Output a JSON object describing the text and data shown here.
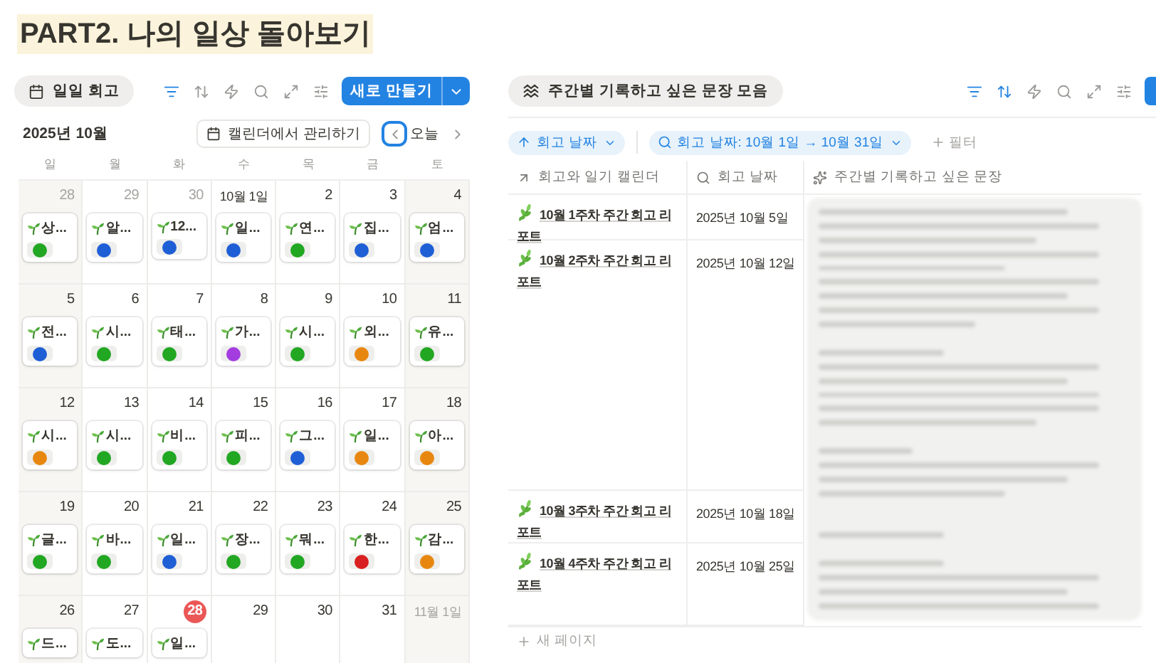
{
  "page_title": "PART2. 나의 일상 돌아보기",
  "calendar": {
    "view_tab": "일일 회고",
    "toolbar": [
      {
        "kind": "filter",
        "active": true
      },
      {
        "kind": "sort",
        "active": false
      },
      {
        "kind": "automation",
        "active": false
      },
      {
        "kind": "search",
        "active": false
      },
      {
        "kind": "expand",
        "active": false
      },
      {
        "kind": "settings",
        "active": false
      }
    ],
    "new_button": "새로 만들기",
    "month": "2025년 10월",
    "manage_button": "캘린더에서 관리하기",
    "today_button": "오늘",
    "weekdays": [
      "일",
      "월",
      "화",
      "수",
      "목",
      "금",
      "토"
    ],
    "weeks": [
      [
        {
          "date": "28",
          "muted": true,
          "today": false,
          "entry": {
            "text": "상...",
            "color": "#22a722"
          }
        },
        {
          "date": "29",
          "muted": true,
          "today": false,
          "entry": {
            "text": "알...",
            "color": "#1f5fd6"
          }
        },
        {
          "date": "30",
          "muted": true,
          "today": false,
          "entry": {
            "text": "12...",
            "color": "#1f5fd6"
          }
        },
        {
          "date": "10월 1일",
          "muted": false,
          "today": false,
          "entry": {
            "text": "일...",
            "color": "#1f5fd6"
          }
        },
        {
          "date": "2",
          "muted": false,
          "today": false,
          "entry": {
            "text": "연...",
            "color": "#22a722"
          }
        },
        {
          "date": "3",
          "muted": false,
          "today": false,
          "entry": {
            "text": "집...",
            "color": "#1f5fd6"
          }
        },
        {
          "date": "4",
          "muted": false,
          "today": false,
          "entry": {
            "text": "엄...",
            "color": "#1f5fd6"
          }
        }
      ],
      [
        {
          "date": "5",
          "muted": false,
          "today": false,
          "entry": {
            "text": "전...",
            "color": "#1f5fd6"
          }
        },
        {
          "date": "6",
          "muted": false,
          "today": false,
          "entry": {
            "text": "시...",
            "color": "#22a722"
          }
        },
        {
          "date": "7",
          "muted": false,
          "today": false,
          "entry": {
            "text": "태...",
            "color": "#22a722"
          }
        },
        {
          "date": "8",
          "muted": false,
          "today": false,
          "entry": {
            "text": "가...",
            "color": "#a43de0"
          }
        },
        {
          "date": "9",
          "muted": false,
          "today": false,
          "entry": {
            "text": "시...",
            "color": "#22a722"
          }
        },
        {
          "date": "10",
          "muted": false,
          "today": false,
          "entry": {
            "text": "외...",
            "color": "#e8870f"
          }
        },
        {
          "date": "11",
          "muted": false,
          "today": false,
          "entry": {
            "text": "유...",
            "color": "#22a722"
          }
        }
      ],
      [
        {
          "date": "12",
          "muted": false,
          "today": false,
          "entry": {
            "text": "시...",
            "color": "#e8870f"
          }
        },
        {
          "date": "13",
          "muted": false,
          "today": false,
          "entry": {
            "text": "시...",
            "color": "#22a722"
          }
        },
        {
          "date": "14",
          "muted": false,
          "today": false,
          "entry": {
            "text": "비...",
            "color": "#22a722"
          }
        },
        {
          "date": "15",
          "muted": false,
          "today": false,
          "entry": {
            "text": "피...",
            "color": "#22a722"
          }
        },
        {
          "date": "16",
          "muted": false,
          "today": false,
          "entry": {
            "text": "그...",
            "color": "#1f5fd6"
          }
        },
        {
          "date": "17",
          "muted": false,
          "today": false,
          "entry": {
            "text": "일...",
            "color": "#e8870f"
          }
        },
        {
          "date": "18",
          "muted": false,
          "today": false,
          "entry": {
            "text": "아...",
            "color": "#e8870f"
          }
        }
      ],
      [
        {
          "date": "19",
          "muted": false,
          "today": false,
          "entry": {
            "text": "글...",
            "color": "#22a722"
          }
        },
        {
          "date": "20",
          "muted": false,
          "today": false,
          "entry": {
            "text": "바...",
            "color": "#22a722"
          }
        },
        {
          "date": "21",
          "muted": false,
          "today": false,
          "entry": {
            "text": "일...",
            "color": "#1f5fd6"
          }
        },
        {
          "date": "22",
          "muted": false,
          "today": false,
          "entry": {
            "text": "장...",
            "color": "#22a722"
          }
        },
        {
          "date": "23",
          "muted": false,
          "today": false,
          "entry": {
            "text": "뭐...",
            "color": "#22a722"
          }
        },
        {
          "date": "24",
          "muted": false,
          "today": false,
          "entry": {
            "text": "한...",
            "color": "#d92020"
          }
        },
        {
          "date": "25",
          "muted": false,
          "today": false,
          "entry": {
            "text": "감...",
            "color": "#e8870f"
          }
        }
      ],
      [
        {
          "date": "26",
          "muted": false,
          "today": false,
          "entry": {
            "text": "드..."
          }
        },
        {
          "date": "27",
          "muted": false,
          "today": false,
          "entry": {
            "text": "도..."
          }
        },
        {
          "date": "28",
          "muted": false,
          "today": true,
          "entry": {
            "text": "일..."
          }
        },
        {
          "date": "29",
          "muted": false,
          "today": false
        },
        {
          "date": "30",
          "muted": false,
          "today": false
        },
        {
          "date": "31",
          "muted": false,
          "today": false
        },
        {
          "date": "11월 1일",
          "muted": true,
          "today": false
        }
      ]
    ]
  },
  "database": {
    "view_tab": "주간별 기록하고 싶은 문장 모음",
    "toolbar": [
      {
        "kind": "filter",
        "active": true
      },
      {
        "kind": "sort",
        "active": true
      },
      {
        "kind": "automation",
        "active": false
      },
      {
        "kind": "search",
        "active": false
      },
      {
        "kind": "expand",
        "active": false
      },
      {
        "kind": "settings",
        "active": false
      }
    ],
    "sort_chip": "회고 날짜",
    "filter_chip": "회고 날짜: 10월 1일 → 10월 31일",
    "add_filter": "필터",
    "columns": [
      {
        "kind": "relation",
        "label": "회고와 일기 캘린더"
      },
      {
        "kind": "search",
        "label": "회고 날짜"
      },
      {
        "kind": "ai",
        "label": "주간별 기록하고 싶은 문장"
      }
    ],
    "rows": [
      {
        "title": "10월 1주차 주간 회고 리포트",
        "date": "2025년 10월 5일"
      },
      {
        "title": "10월 2주차 주간 회고 리포트",
        "date": "2025년 10월 12일"
      },
      {
        "title": "10월 3주차 주간 회고 리포트",
        "date": "2025년 10월 18일"
      },
      {
        "title": "10월 4주차 주간 회고 리포트",
        "date": "2025년 10월 25일"
      }
    ],
    "new_page": "새 페이지"
  }
}
